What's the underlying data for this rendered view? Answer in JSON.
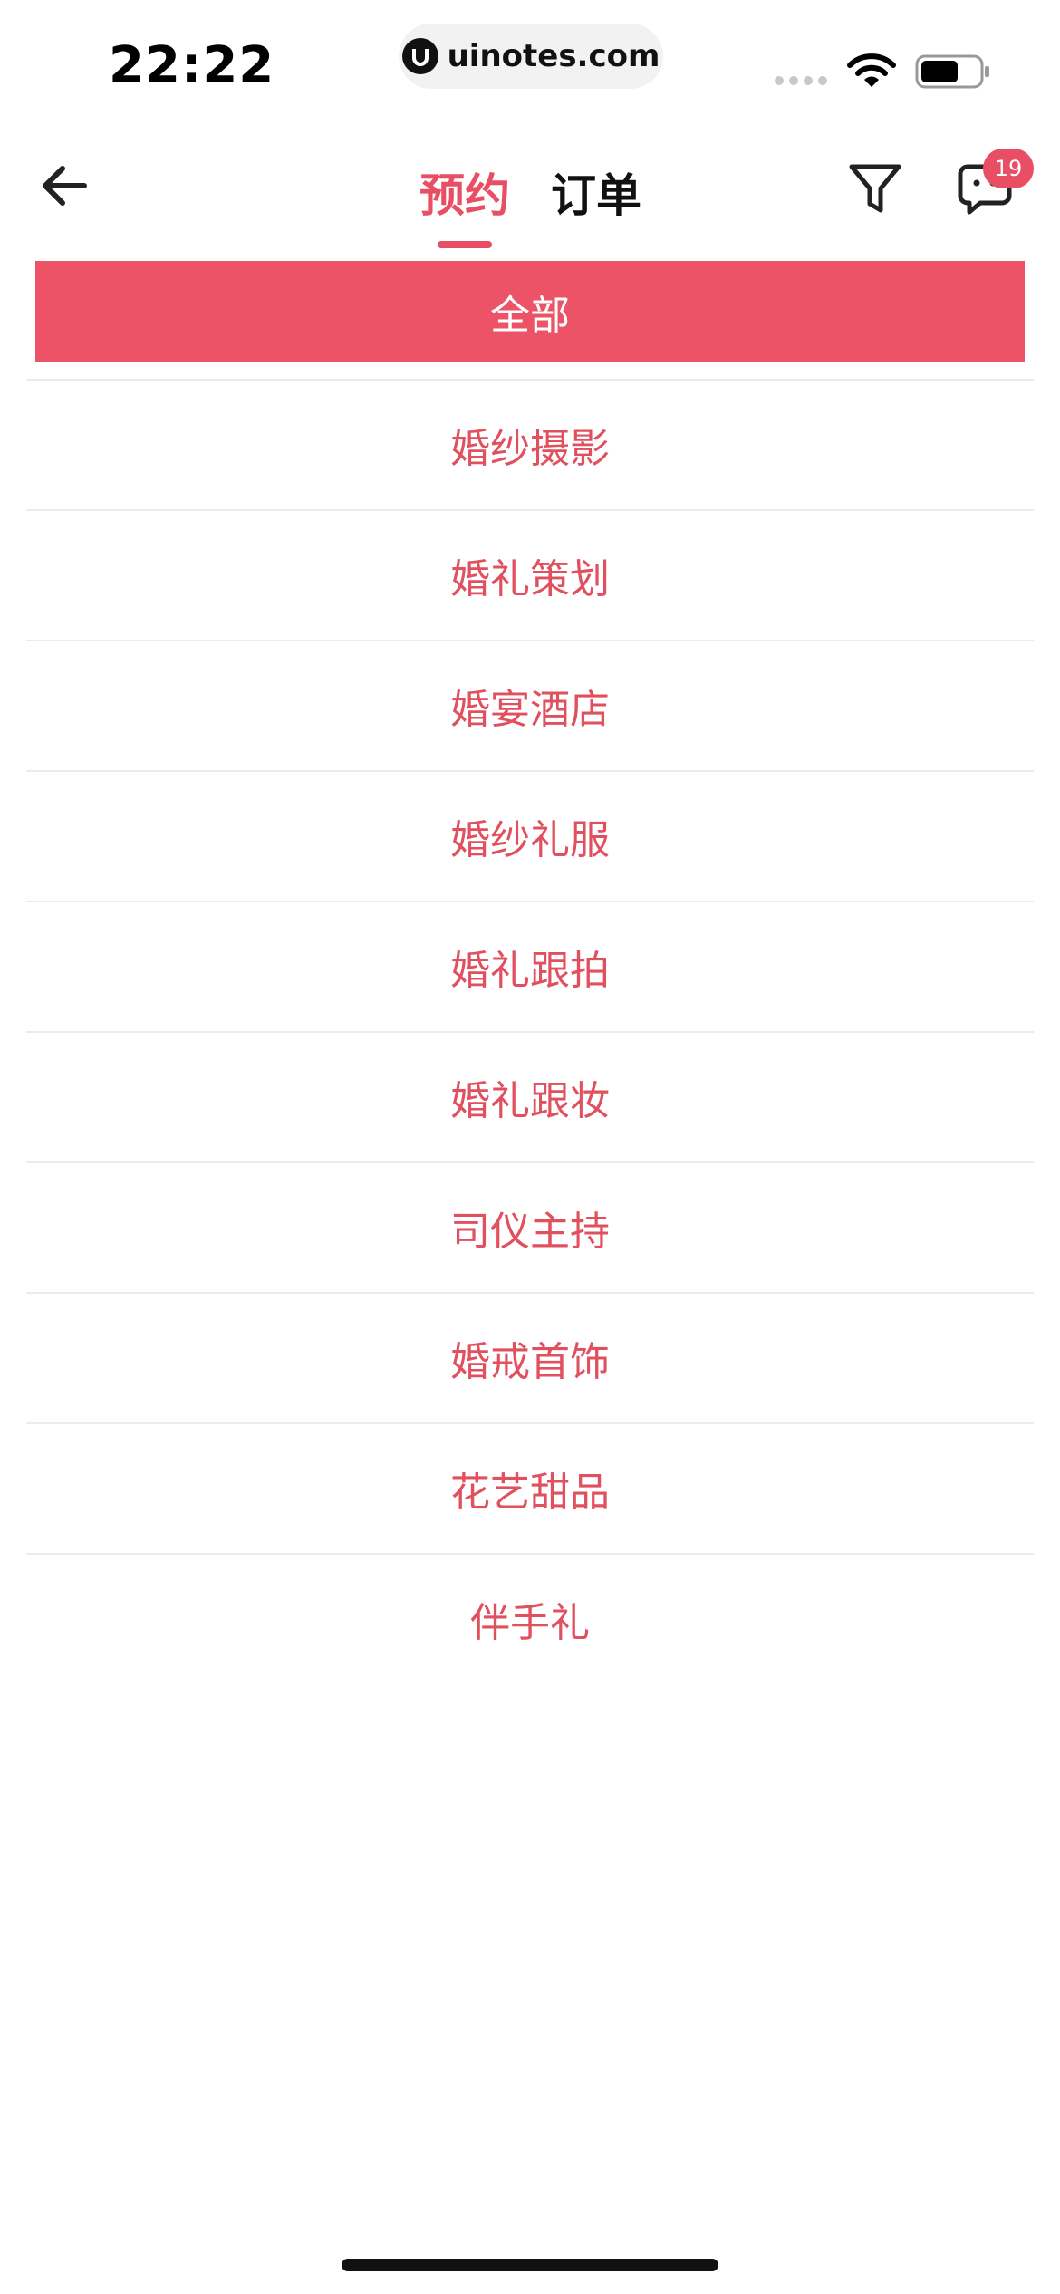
{
  "status_bar": {
    "time": "22:22",
    "url": "uinotes.com"
  },
  "nav": {
    "tabs": [
      {
        "label": "预约",
        "active": true
      },
      {
        "label": "订单",
        "active": false
      }
    ],
    "message_badge": "19",
    "icons": {
      "back": "arrow-left-icon",
      "filter": "filter-icon",
      "message": "message-icon"
    }
  },
  "categories": {
    "selected": "全部",
    "items": [
      {
        "label": "婚纱摄影"
      },
      {
        "label": "婚礼策划"
      },
      {
        "label": "婚宴酒店"
      },
      {
        "label": "婚纱礼服"
      },
      {
        "label": "婚礼跟拍"
      },
      {
        "label": "婚礼跟妆"
      },
      {
        "label": "司仪主持"
      },
      {
        "label": "婚戒首饰"
      },
      {
        "label": "花艺甜品"
      },
      {
        "label": "伴手礼"
      }
    ]
  },
  "colors": {
    "accent": "#e94f64",
    "selected_bg": "#ec5366",
    "item_text": "#e0505f"
  }
}
